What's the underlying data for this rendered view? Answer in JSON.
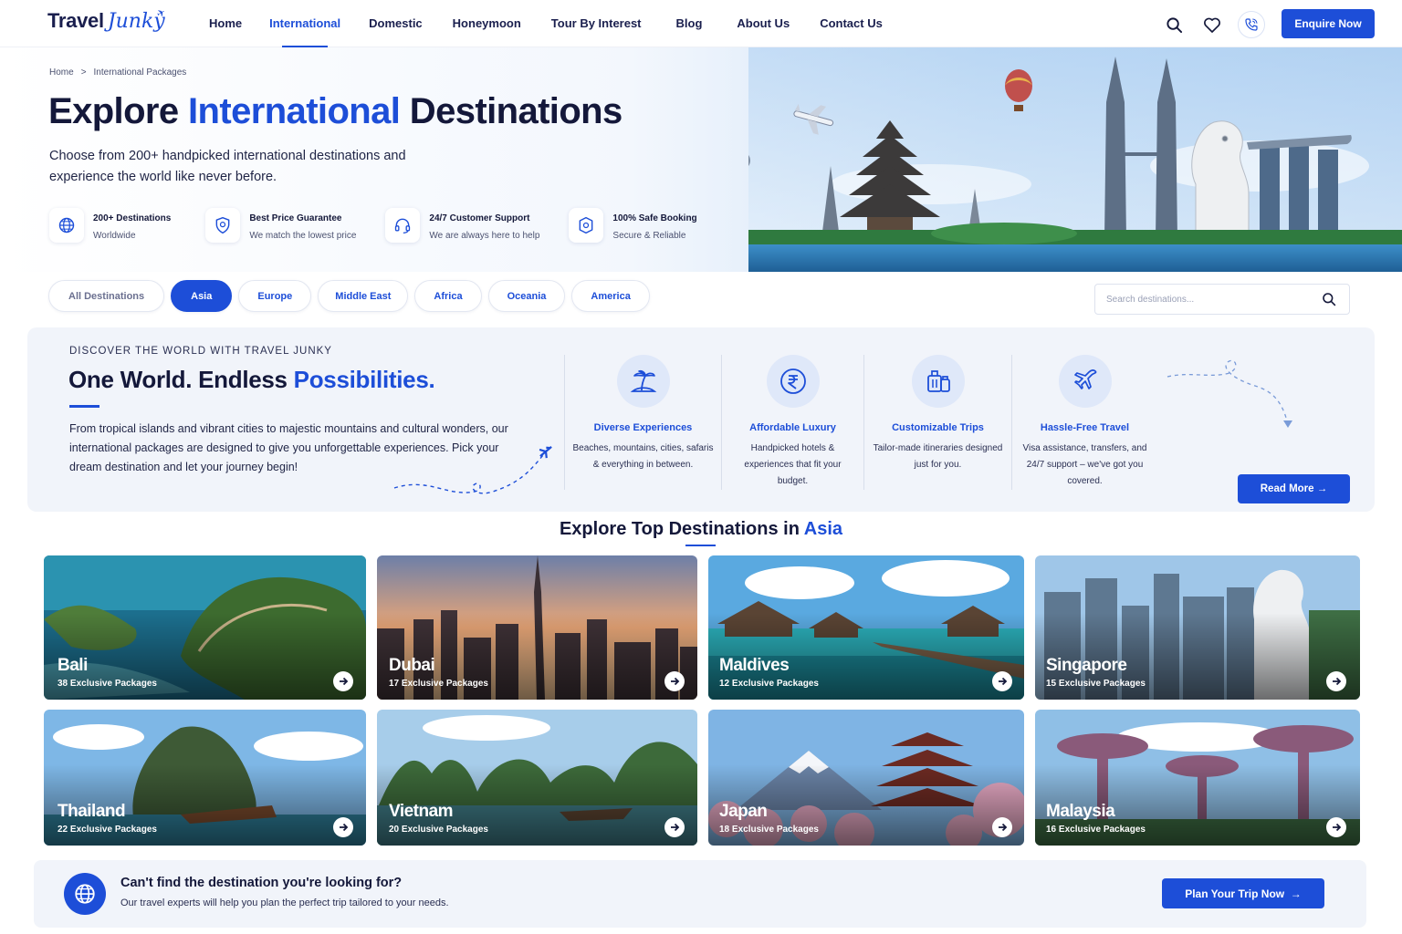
{
  "brand": {
    "name_part1": "Travel",
    "name_part2": "Junky"
  },
  "nav": {
    "items": [
      {
        "label": "Home",
        "active": false
      },
      {
        "label": "International",
        "active": true
      },
      {
        "label": "Domestic",
        "active": false
      },
      {
        "label": "Honeymoon",
        "active": false
      },
      {
        "label": "Tour By Interest",
        "active": false
      },
      {
        "label": "Blog",
        "active": false
      },
      {
        "label": "About Us",
        "active": false
      },
      {
        "label": "Contact Us",
        "active": false
      }
    ],
    "icons": [
      "search-icon",
      "heart-icon",
      "phone-icon"
    ],
    "enquire_label": "Enquire Now"
  },
  "breadcrumb": {
    "home": "Home",
    "separator": ">",
    "current": "International Packages"
  },
  "hero": {
    "title_part1": "Explore",
    "title_highlight": "International",
    "title_part2": "Destinations",
    "subtitle": "Choose from 200+ handpicked international destinations and experience the world like never before.",
    "features": [
      {
        "icon": "globe-icon",
        "title": "200+ Destinations",
        "desc": "Worldwide"
      },
      {
        "icon": "shield-icon",
        "title": "Best Price Guarantee",
        "desc": "We match the lowest price"
      },
      {
        "icon": "headset-icon",
        "title": "24/7 Customer Support",
        "desc": "We are always here to help"
      },
      {
        "icon": "secure-icon",
        "title": "100% Safe Booking",
        "desc": "Secure & Reliable"
      }
    ]
  },
  "filters": {
    "chips": [
      {
        "label": "All Destinations",
        "active": false
      },
      {
        "label": "Asia",
        "active": true
      },
      {
        "label": "Europe",
        "active": false
      },
      {
        "label": "Middle East",
        "active": false
      },
      {
        "label": "Africa",
        "active": false
      },
      {
        "label": "Oceania",
        "active": false
      },
      {
        "label": "America",
        "active": false
      }
    ],
    "search_placeholder": "Search destinations..."
  },
  "info": {
    "eyebrow": "DISCOVER THE WORLD WITH TRAVEL JUNKY",
    "title_part1": "One World. Endless",
    "title_highlight": "Possibilities.",
    "text": "From tropical islands and vibrant cities to majestic mountains and cultural wonders, our international packages are designed to give you unforgettable experiences. Pick your dream destination and let your journey begin!",
    "pillars": [
      {
        "icon": "island-icon",
        "title": "Diverse Experiences",
        "desc": "Beaches, mountains, cities, safaris & everything in between."
      },
      {
        "icon": "rupee-icon",
        "title": "Affordable Luxury",
        "desc": "Handpicked hotels & experiences that fit your budget."
      },
      {
        "icon": "luggage-icon",
        "title": "Customizable Trips",
        "desc": "Tailor-made itineraries designed just for you."
      },
      {
        "icon": "airplane-icon",
        "title": "Hassle-Free Travel",
        "desc": "Visa assistance, transfers, and 24/7 support – we've got you covered."
      }
    ],
    "read_more_label": "Read More"
  },
  "section": {
    "title_part1": "Explore Top Destinations in",
    "title_highlight": "Asia"
  },
  "destinations": [
    {
      "name": "Bali",
      "packages": "38 Exclusive Packages"
    },
    {
      "name": "Dubai",
      "packages": "17 Exclusive Packages"
    },
    {
      "name": "Maldives",
      "packages": "12 Exclusive Packages"
    },
    {
      "name": "Singapore",
      "packages": "15 Exclusive Packages"
    },
    {
      "name": "Thailand",
      "packages": "22 Exclusive Packages"
    },
    {
      "name": "Vietnam",
      "packages": "20 Exclusive Packages"
    },
    {
      "name": "Japan",
      "packages": "18 Exclusive Packages"
    },
    {
      "name": "Malaysia",
      "packages": "16 Exclusive Packages"
    }
  ],
  "cta": {
    "title": "Can't find the destination you're looking for?",
    "desc": "Our travel experts will help you plan the perfect trip tailored to your needs.",
    "button_label": "Plan Your Trip Now"
  },
  "colors": {
    "accent": "#1d4ed8",
    "text": "#14183a",
    "panel": "#f1f4fa"
  }
}
